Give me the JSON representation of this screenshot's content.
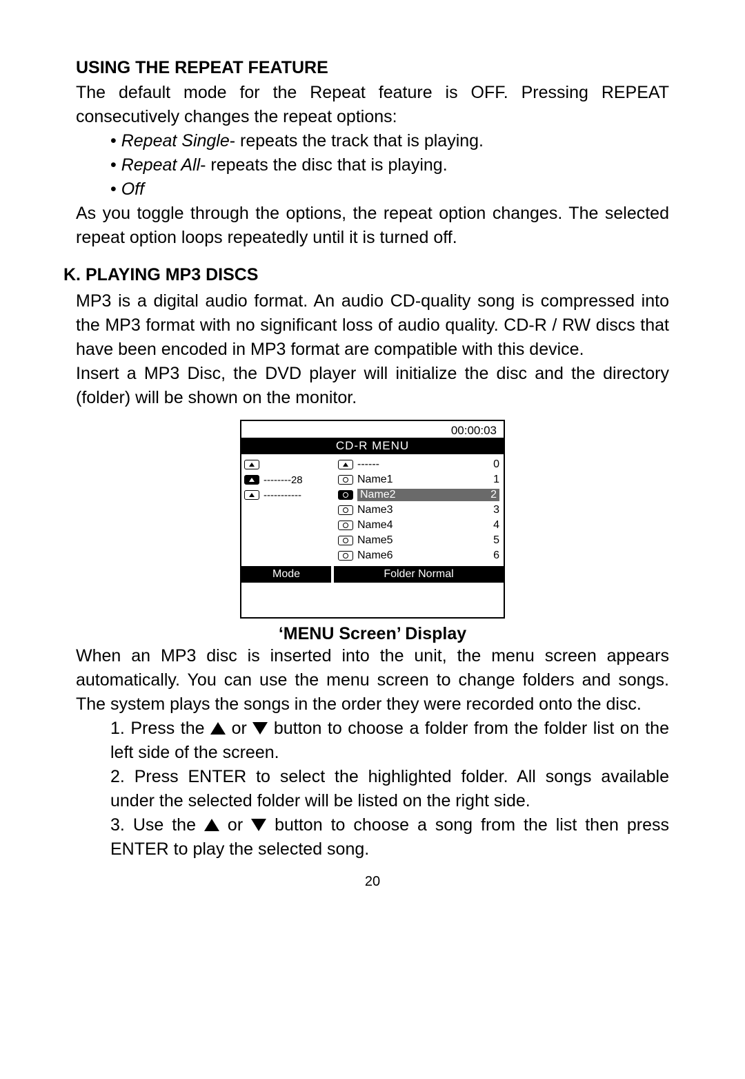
{
  "section_repeat_heading": "USING THE REPEAT FEATURE",
  "section_repeat_intro": "The default mode for the Repeat feature is OFF. Pressing REPEAT consecutively  changes the repeat options:",
  "bullets": {
    "b1_ital": "Repeat Single",
    "b1_rest": "- repeats the track that is playing.",
    "b2_ital": "Repeat All",
    "b2_rest": "- repeats the disc that is playing.",
    "b3_ital": "Off"
  },
  "section_repeat_outro": "As you toggle through the options, the repeat option changes.  The selected repeat option loops repeatedly until it is turned off.",
  "k_heading": "K. PLAYING MP3 DISCS",
  "k_para1": "MP3 is a digital audio format.  An audio CD-quality song is compressed into the MP3 format with no significant loss of audio quality. CD-R / RW discs that have been encoded in MP3 format are compatible with this device.",
  "k_para2": "Insert  a MP3 Disc, the DVD  player will initialize the disc and the directory (folder) will be shown on the monitor.",
  "cdr": {
    "time": "00:00:03",
    "title": "CD-R MENU",
    "left": [
      {
        "label": "",
        "dash": "",
        "sel": false
      },
      {
        "label": "--------28",
        "dash": "",
        "sel": true
      },
      {
        "label": "-----------",
        "dash": "",
        "sel": false
      }
    ],
    "right": [
      {
        "type": "folder",
        "label": "------",
        "num": "0",
        "sel": false
      },
      {
        "type": "file",
        "label": "Name1",
        "num": "1",
        "sel": false
      },
      {
        "type": "file",
        "label": "Name2",
        "num": "2",
        "sel": true
      },
      {
        "type": "file",
        "label": "Name3",
        "num": "3",
        "sel": false
      },
      {
        "type": "file",
        "label": "Name4",
        "num": "4",
        "sel": false
      },
      {
        "type": "file",
        "label": "Name5",
        "num": "5",
        "sel": false
      },
      {
        "type": "file",
        "label": "Name6",
        "num": "6",
        "sel": false
      }
    ],
    "mode_left": "Mode",
    "mode_right": "Folder Normal"
  },
  "figure_caption": "‘MENU Screen’ Display",
  "menu_para": "When an MP3 disc is inserted into the unit, the menu screen appears automatically. You can use the menu screen to change folders and songs. The system plays the songs in the order they were recorded onto the disc.",
  "steps": {
    "s1a": "1. Press the ",
    "s1b": "  or ",
    "s1c": " button to choose a folder from the folder list on the left side of the screen.",
    "s2": "2. Press ENTER to select the highlighted folder.  All songs available under the selected  folder will be listed on the right side.",
    "s3a": "3. Use the  ",
    "s3b": "  or ",
    "s3c": " button to choose a song from the list  then press ENTER to play the selected song."
  },
  "page_number": "20"
}
